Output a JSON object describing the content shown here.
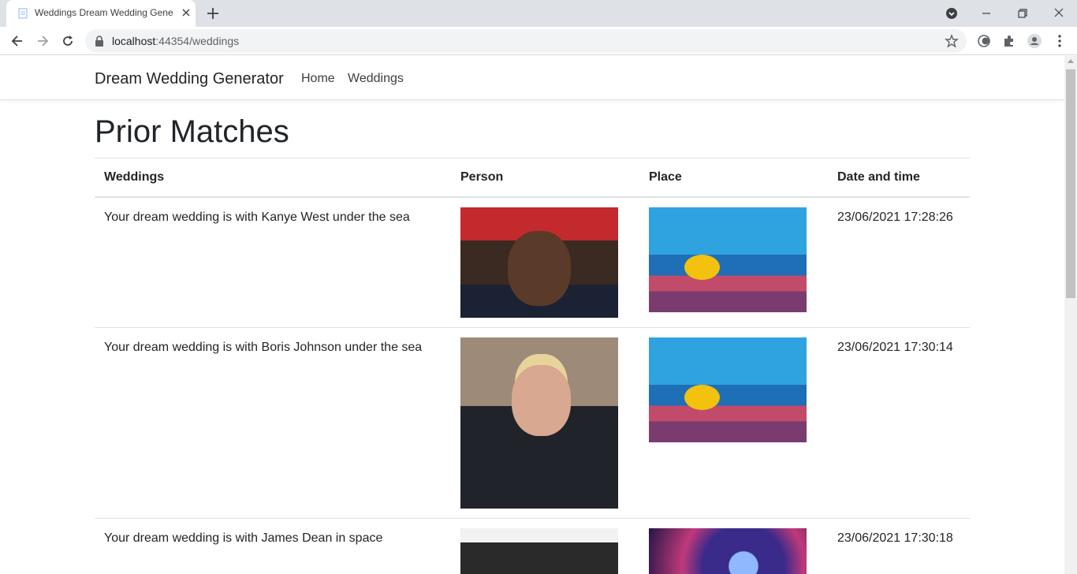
{
  "browser": {
    "tab_title": "Weddings Dream Wedding Gene",
    "url_host": "localhost",
    "url_rest": ":44354/weddings"
  },
  "navbar": {
    "brand": "Dream Wedding Generator",
    "links": [
      "Home",
      "Weddings"
    ]
  },
  "page": {
    "heading": "Prior Matches"
  },
  "table": {
    "headers": [
      "Weddings",
      "Person",
      "Place",
      "Date and time"
    ],
    "rows": [
      {
        "wedding": "Your dream wedding is with Kanye West under the sea",
        "person_image": "Kanye West photo",
        "place_image": "under the sea photo",
        "datetime": "23/06/2021 17:28:26"
      },
      {
        "wedding": "Your dream wedding is with Boris Johnson under the sea",
        "person_image": "Boris Johnson photo",
        "place_image": "under the sea photo",
        "datetime": "23/06/2021 17:30:14"
      },
      {
        "wedding": "Your dream wedding is with James Dean in space",
        "person_image": "James Dean photo",
        "place_image": "space photo",
        "datetime": "23/06/2021 17:30:18"
      }
    ]
  }
}
